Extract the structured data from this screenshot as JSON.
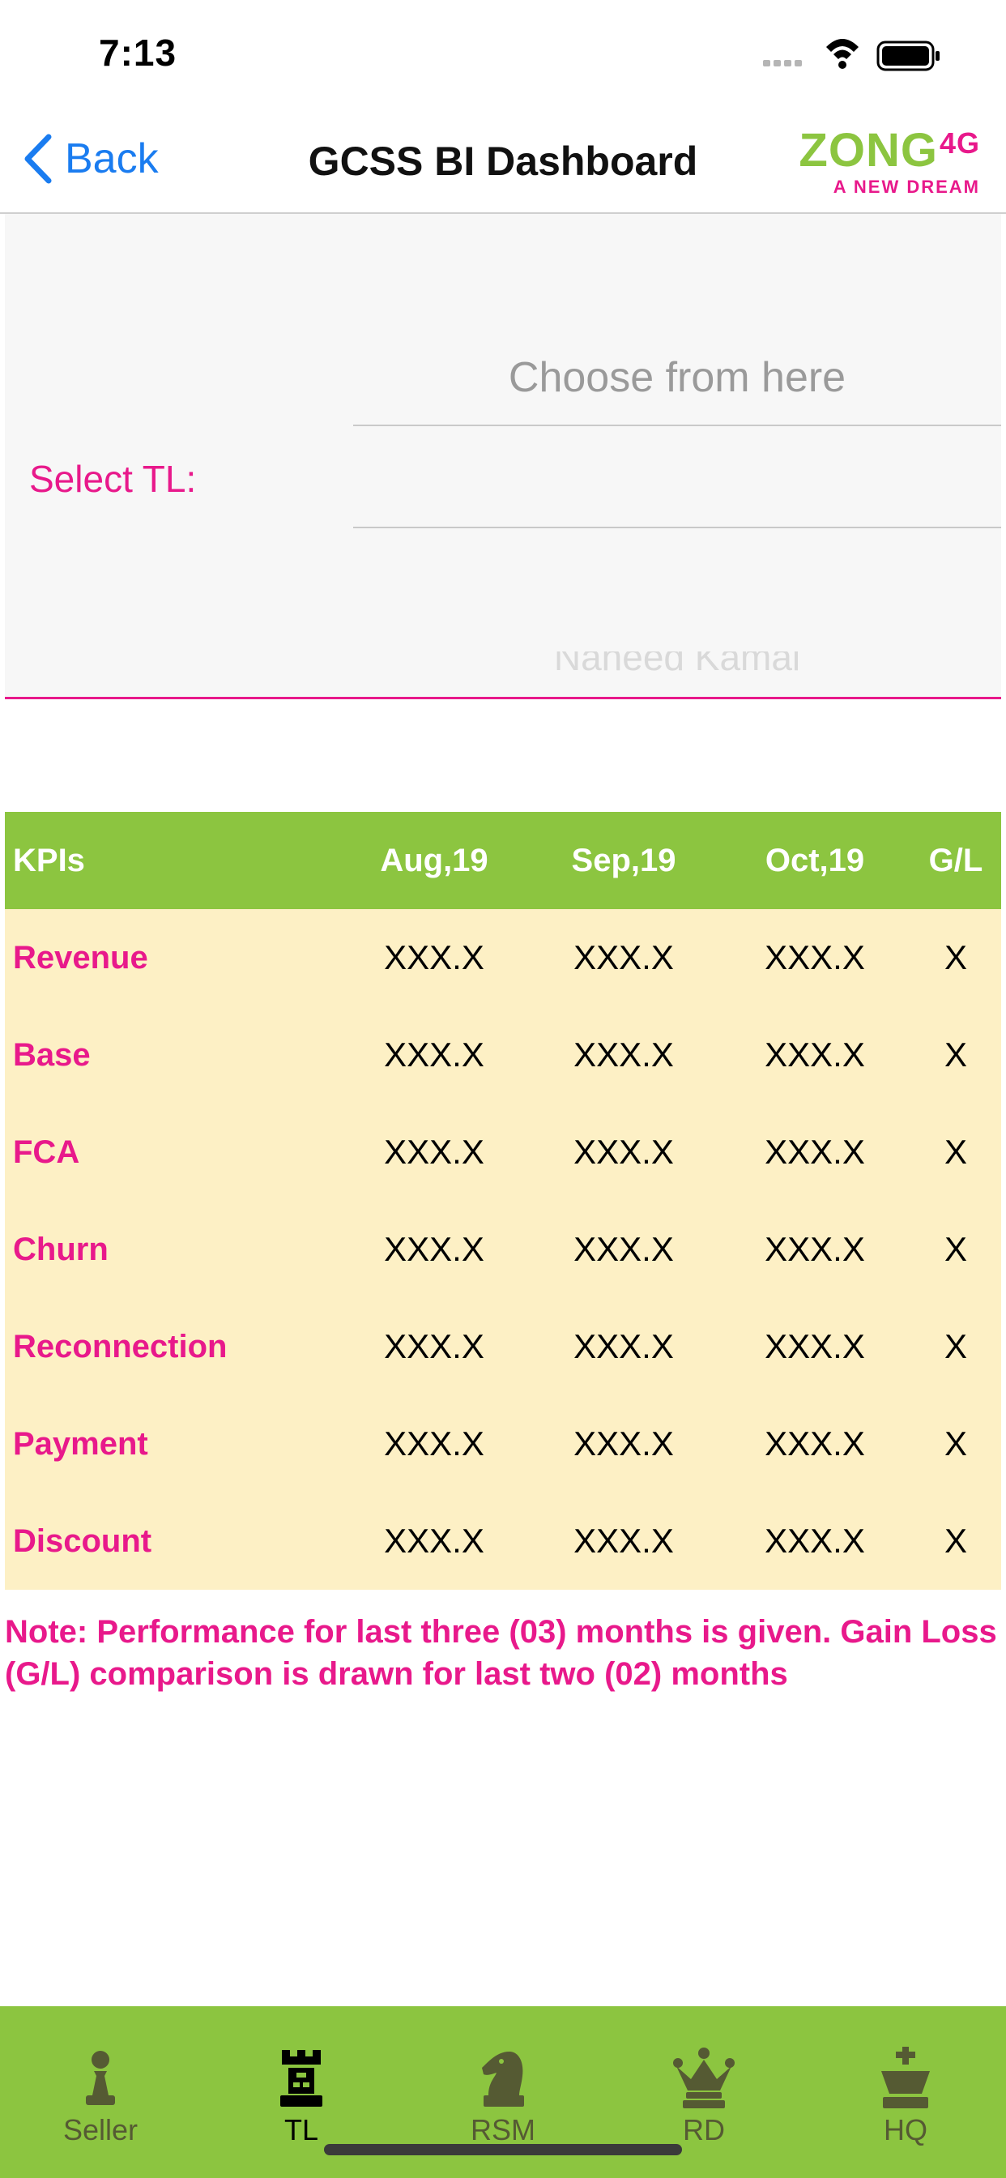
{
  "status_bar": {
    "time": "7:13"
  },
  "nav": {
    "back_label": "Back",
    "title": "GCSS BI Dashboard",
    "brand_name": "ZONG",
    "brand_suffix": "4G",
    "brand_tagline": "A NEW DREAM"
  },
  "selector": {
    "label": "Select TL:",
    "placeholder": "Choose from here",
    "partial_option": "Naheed Kamal"
  },
  "table": {
    "headers": [
      "KPIs",
      "Aug,19",
      "Sep,19",
      "Oct,19",
      "G/L"
    ],
    "rows": [
      {
        "kpi": "Revenue",
        "aug": "XXX.X",
        "sep": "XXX.X",
        "oct": "XXX.X",
        "gl": "X"
      },
      {
        "kpi": "Base",
        "aug": "XXX.X",
        "sep": "XXX.X",
        "oct": "XXX.X",
        "gl": "X"
      },
      {
        "kpi": "FCA",
        "aug": "XXX.X",
        "sep": "XXX.X",
        "oct": "XXX.X",
        "gl": "X"
      },
      {
        "kpi": "Churn",
        "aug": "XXX.X",
        "sep": "XXX.X",
        "oct": "XXX.X",
        "gl": "X"
      },
      {
        "kpi": "Reconnection",
        "aug": "XXX.X",
        "sep": "XXX.X",
        "oct": "XXX.X",
        "gl": "X"
      },
      {
        "kpi": "Payment",
        "aug": "XXX.X",
        "sep": "XXX.X",
        "oct": "XXX.X",
        "gl": "X"
      },
      {
        "kpi": "Discount",
        "aug": "XXX.X",
        "sep": "XXX.X",
        "oct": "XXX.X",
        "gl": "X"
      }
    ]
  },
  "note": "Note: Performance for last three (03) months is given. Gain Loss (G/L) comparison is drawn for last two (02) months",
  "tabs": [
    {
      "label": "Seller",
      "icon": "chess-pawn-icon",
      "active": false
    },
    {
      "label": "TL",
      "icon": "chess-rook-icon",
      "active": true
    },
    {
      "label": "RSM",
      "icon": "chess-knight-icon",
      "active": false
    },
    {
      "label": "RD",
      "icon": "chess-queen-icon",
      "active": false
    },
    {
      "label": "HQ",
      "icon": "chess-king-icon",
      "active": false
    }
  ],
  "colors": {
    "accent_green": "#8cc540",
    "accent_pink": "#e8198b",
    "link_blue": "#1a7cf0",
    "table_row_bg": "#fdf0c5",
    "tab_icon_inactive": "#555a33",
    "tab_icon_active": "#000000"
  }
}
